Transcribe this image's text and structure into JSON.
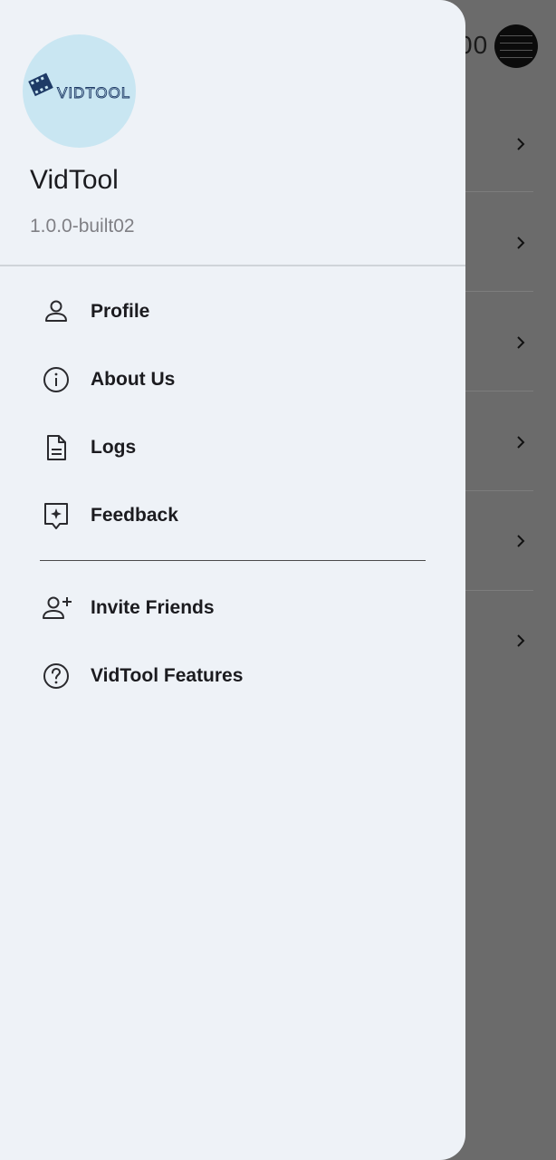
{
  "background": {
    "header_fragment": "00",
    "row_count": 6
  },
  "drawer": {
    "logo_text": "VIDTOOL",
    "app_name": "VidTool",
    "version": "1.0.0-built02",
    "menu": [
      {
        "label": "Profile",
        "icon": "person-icon"
      },
      {
        "label": "About Us",
        "icon": "info-icon"
      },
      {
        "label": "Logs",
        "icon": "document-icon"
      },
      {
        "label": "Feedback",
        "icon": "feedback-icon"
      }
    ],
    "secondary_menu": [
      {
        "label": "Invite Friends",
        "icon": "person-add-icon"
      },
      {
        "label": "VidTool Features",
        "icon": "help-icon"
      }
    ]
  },
  "colors": {
    "drawer_bg": "#eef2f7",
    "scrim": "#6b6b6b",
    "logo_bg": "#c9e6f2",
    "logo_ink": "#1e3a66"
  }
}
